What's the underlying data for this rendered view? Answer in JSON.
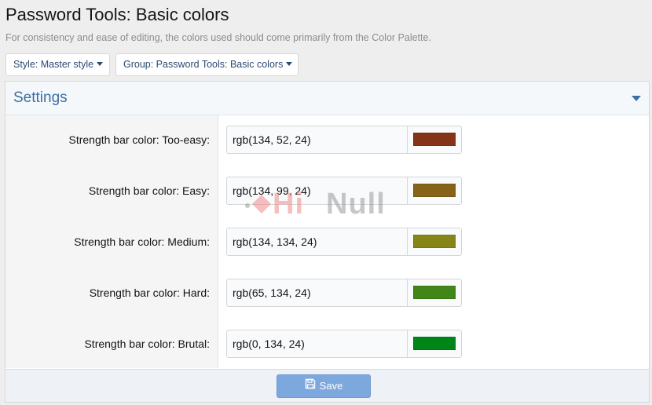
{
  "page": {
    "title": "Password Tools: Basic colors",
    "description": "For consistency and ease of editing, the colors used should come primarily from the Color Palette."
  },
  "filters": {
    "style_label": "Style: Master style",
    "group_label": "Group: Password Tools: Basic colors"
  },
  "settings": {
    "title": "Settings",
    "rows": [
      {
        "label": "Strength bar color: Too-easy:",
        "value": "rgb(134, 52, 24)",
        "color": "#863418"
      },
      {
        "label": "Strength bar color: Easy:",
        "value": "rgb(134, 99, 24)",
        "color": "#866318"
      },
      {
        "label": "Strength bar color: Medium:",
        "value": "rgb(134, 134, 24)",
        "color": "#868618"
      },
      {
        "label": "Strength bar color: Hard:",
        "value": "rgb(65, 134, 24)",
        "color": "#418618"
      },
      {
        "label": "Strength bar color: Brutal:",
        "value": "rgb(0, 134, 24)",
        "color": "#008618"
      }
    ]
  },
  "footer": {
    "save_label": "Save"
  },
  "watermark": {
    "text_hi": "Hi",
    "text_null": "Null"
  },
  "colors": {
    "accent": "#3d6fa4",
    "save_button": "#7da8de"
  }
}
